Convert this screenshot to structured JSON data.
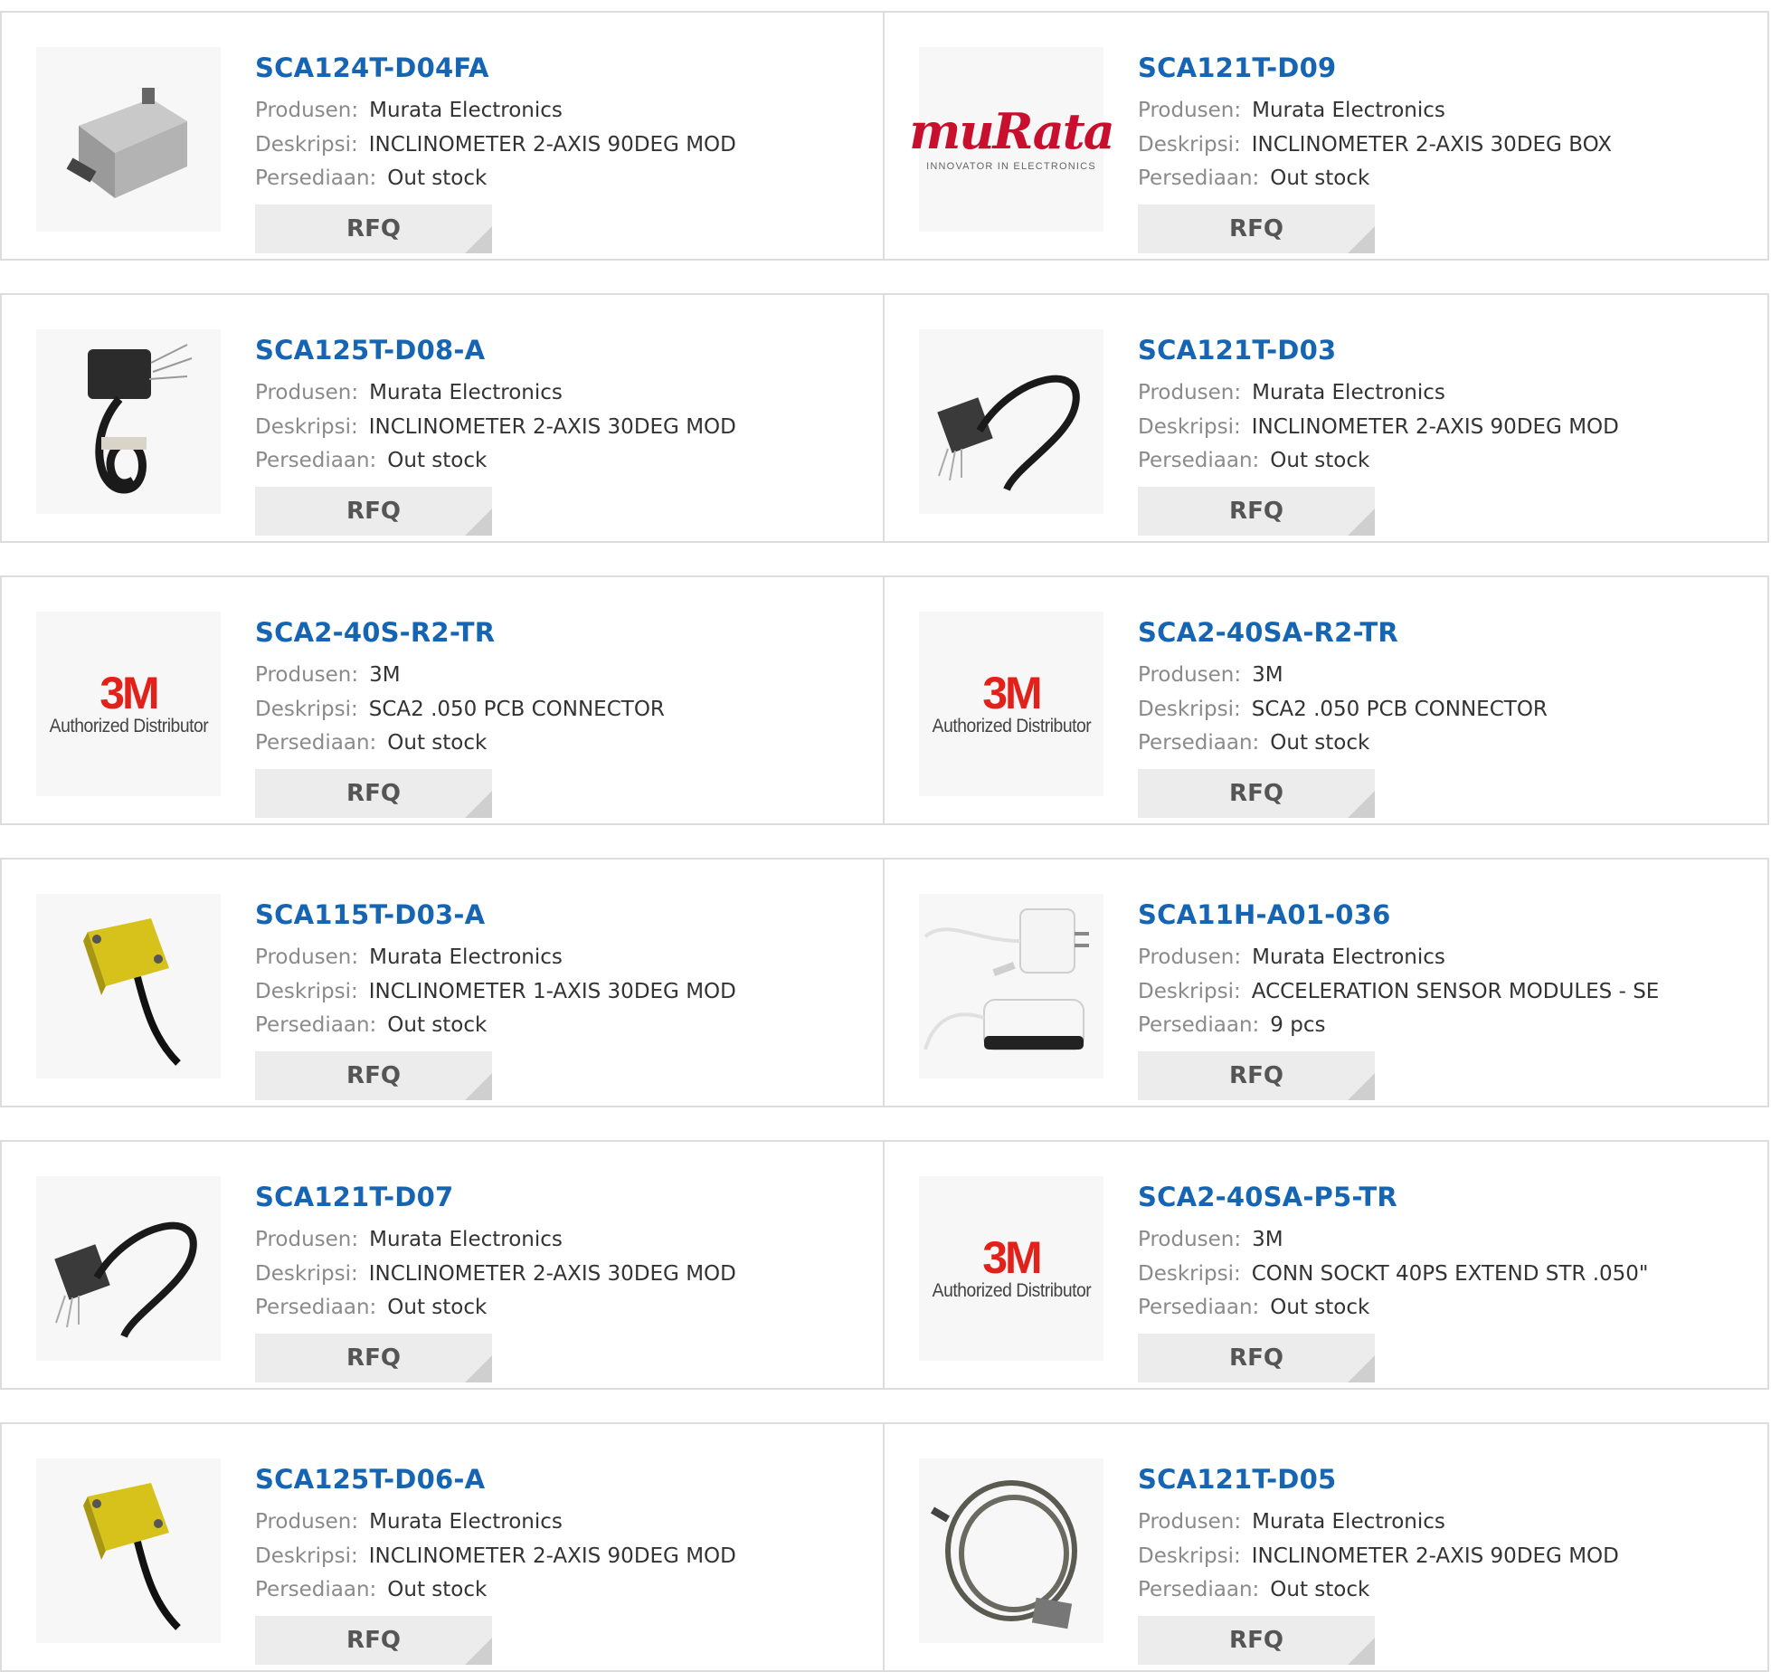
{
  "labels": {
    "manufacturer": "Produsen:",
    "description": "Deskripsi:",
    "stock": "Persediaan:",
    "rfq": "RFQ"
  },
  "brand_logos": {
    "murata": {
      "name": "muRata",
      "tagline": "INNOVATOR IN ELECTRONICS"
    },
    "3m": {
      "name": "3M",
      "tagline": "Authorized Distributor"
    }
  },
  "colors": {
    "part_link": "#1565b3",
    "label_gray": "#8a8a8a",
    "border": "#dcdcdc",
    "rfq_bg": "#ececec",
    "murata_red": "#c8102e",
    "3m_red": "#e3211b"
  },
  "products": [
    {
      "part": "SCA124T-D04FA",
      "manufacturer": "Murata Electronics",
      "description": "INCLINOMETER 2-AXIS 90DEG MOD",
      "stock": "Out stock",
      "image": "gray-box-sensor-icon"
    },
    {
      "part": "SCA121T-D09",
      "manufacturer": "Murata Electronics",
      "description": "INCLINOMETER 2-AXIS 30DEG BOX",
      "stock": "Out stock",
      "image": "murata-logo"
    },
    {
      "part": "SCA125T-D08-A",
      "manufacturer": "Murata Electronics",
      "description": "INCLINOMETER 2-AXIS 30DEG MOD",
      "stock": "Out stock",
      "image": "black-sensor-coiled-cable-icon"
    },
    {
      "part": "SCA121T-D03",
      "manufacturer": "Murata Electronics",
      "description": "INCLINOMETER 2-AXIS 90DEG MOD",
      "stock": "Out stock",
      "image": "sensor-cable-loop-icon"
    },
    {
      "part": "SCA2-40S-R2-TR",
      "manufacturer": "3M",
      "description": "SCA2 .050 PCB CONNECTOR",
      "stock": "Out stock",
      "image": "3m-logo"
    },
    {
      "part": "SCA2-40SA-R2-TR",
      "manufacturer": "3M",
      "description": "SCA2 .050 PCB CONNECTOR",
      "stock": "Out stock",
      "image": "3m-logo"
    },
    {
      "part": "SCA115T-D03-A",
      "manufacturer": "Murata Electronics",
      "description": "INCLINOMETER 1-AXIS 30DEG MOD",
      "stock": "Out stock",
      "image": "yellow-sensor-cable-icon"
    },
    {
      "part": "SCA11H-A01-036",
      "manufacturer": "Murata Electronics",
      "description": "ACCELERATION SENSOR MODULES - SE",
      "stock": "9 pcs",
      "image": "white-adapter-module-icon"
    },
    {
      "part": "SCA121T-D07",
      "manufacturer": "Murata Electronics",
      "description": "INCLINOMETER 2-AXIS 30DEG MOD",
      "stock": "Out stock",
      "image": "sensor-cable-loop-icon"
    },
    {
      "part": "SCA2-40SA-P5-TR",
      "manufacturer": "3M",
      "description": "CONN SOCKT 40PS EXTEND STR .050\"",
      "stock": "Out stock",
      "image": "3m-logo"
    },
    {
      "part": "SCA125T-D06-A",
      "manufacturer": "Murata Electronics",
      "description": "INCLINOMETER 2-AXIS 90DEG MOD",
      "stock": "Out stock",
      "image": "yellow-sensor-cable-icon"
    },
    {
      "part": "SCA121T-D05",
      "manufacturer": "Murata Electronics",
      "description": "INCLINOMETER 2-AXIS 90DEG MOD",
      "stock": "Out stock",
      "image": "coiled-gray-cable-icon"
    }
  ]
}
